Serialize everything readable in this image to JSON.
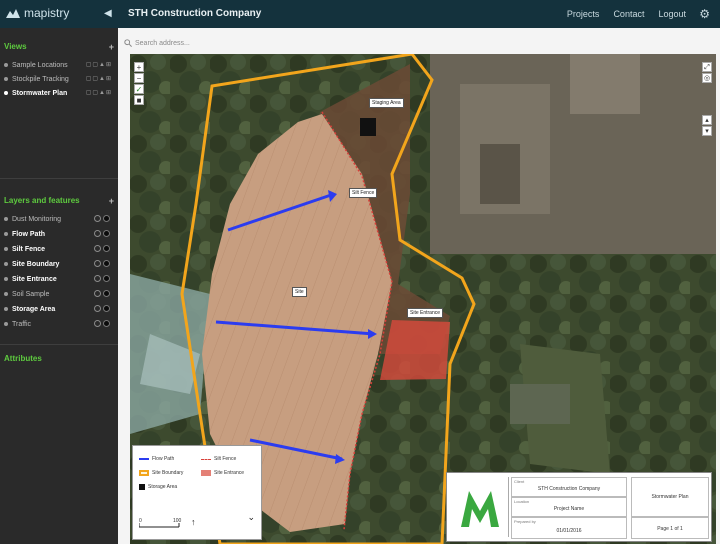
{
  "brand": {
    "name": "mapistry",
    "icon": "mountain-logo-icon"
  },
  "header": {
    "project_title": "STH Construction Company",
    "nav": [
      "Projects",
      "Contact",
      "Logout"
    ],
    "collapse_icon": "chevron-left-icon",
    "settings_icon": "gear-icon"
  },
  "sidebar": {
    "views": {
      "title": "Views",
      "add_icon": "plus-icon",
      "items": [
        {
          "label": "Sample Locations",
          "active": false
        },
        {
          "label": "Stockpile Tracking",
          "active": false
        },
        {
          "label": "Stormwater Plan",
          "active": true
        }
      ]
    },
    "layers": {
      "title": "Layers and features",
      "add_icon": "plus-icon",
      "items": [
        {
          "label": "Dust Monitoring",
          "on": false
        },
        {
          "label": "Flow Path",
          "on": true
        },
        {
          "label": "Silt Fence",
          "on": true
        },
        {
          "label": "Site Boundary",
          "on": true
        },
        {
          "label": "Site Entrance",
          "on": true
        },
        {
          "label": "Soil Sample",
          "on": false
        },
        {
          "label": "Storage Area",
          "on": true
        },
        {
          "label": "Traffic",
          "on": false
        }
      ]
    },
    "attributes": {
      "title": "Attributes"
    }
  },
  "search": {
    "placeholder": "Search address...",
    "icon": "search-icon"
  },
  "map": {
    "labels": {
      "storage": "Staging Area",
      "silt_fence": "Silt Fence",
      "site": "Site",
      "entrance": "Site Entrance"
    },
    "colors": {
      "boundary": "#f2a51c",
      "flow": "#2b3cf0",
      "silt": "#d8403a",
      "entrance_fill": "#d84a3c",
      "site_fill": "#c8a083"
    }
  },
  "legend": {
    "items": [
      "Flow Path",
      "Silt Fence",
      "Site Boundary",
      "Site Entrance",
      "Storage Area"
    ],
    "scale": [
      "0",
      "100"
    ],
    "expand_icon": "chevron-down-icon"
  },
  "titleblock": {
    "company": "STH Construction Company",
    "plan": "Stormwater Plan",
    "project": "Project Name",
    "date": "01/01/2016",
    "page": "Page 1 of 1",
    "captions": [
      "Client",
      "Location",
      "Prepared by"
    ]
  }
}
